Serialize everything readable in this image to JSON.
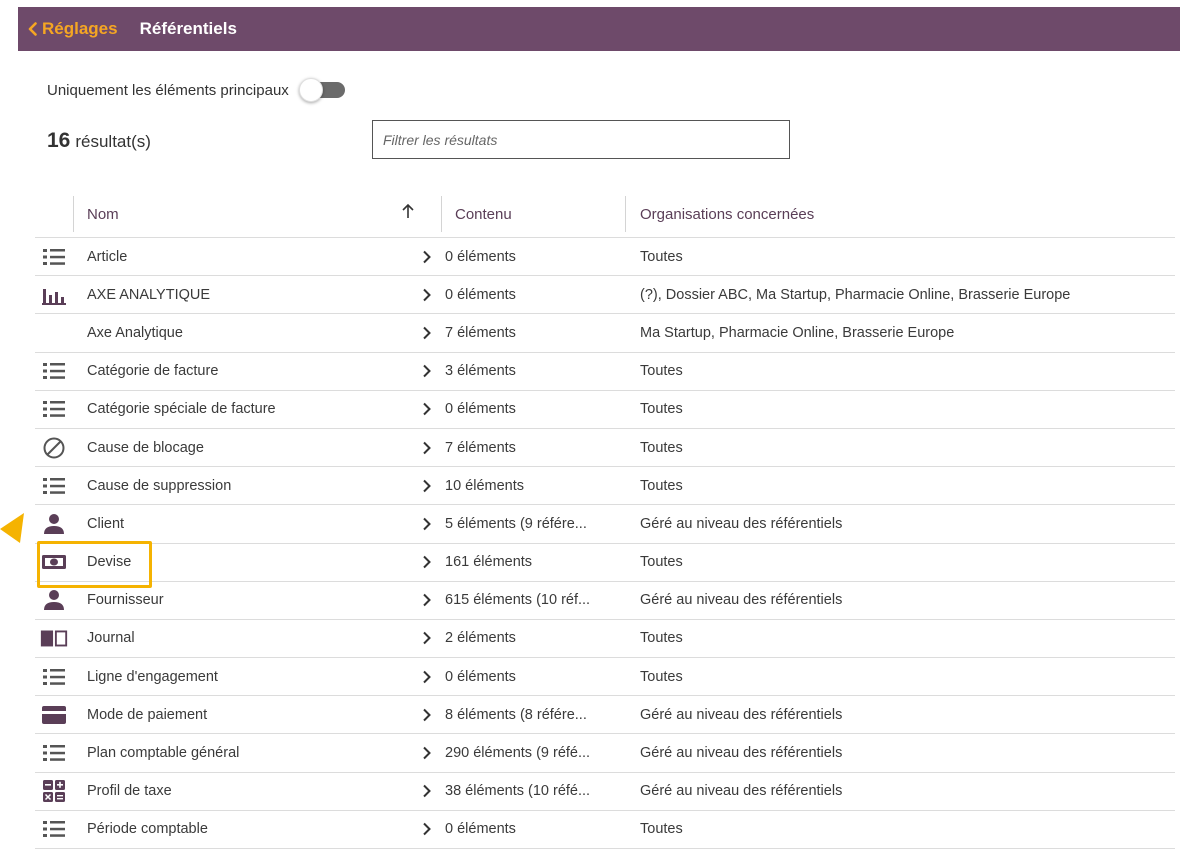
{
  "header": {
    "back_label": "Réglages",
    "title": "Référentiels",
    "colors": {
      "bar": "#6e4a6a",
      "accent": "#f5a623"
    }
  },
  "toggle": {
    "label": "Uniquement les éléments principaux",
    "on": false
  },
  "results": {
    "count": "16",
    "label": "résultat(s)"
  },
  "filter": {
    "placeholder": "Filtrer les résultats",
    "value": ""
  },
  "table": {
    "columns": {
      "name": "Nom",
      "content": "Contenu",
      "orgs": "Organisations concernées"
    },
    "sort": {
      "column": "name",
      "direction": "ascending",
      "icon": "arrow-up-icon"
    },
    "rows": [
      {
        "icon": "list",
        "name": "Article",
        "content": "0 éléments",
        "orgs": "Toutes"
      },
      {
        "icon": "bar-chart",
        "name": "AXE ANALYTIQUE",
        "content": "0 éléments",
        "orgs": "(?), Dossier ABC, Ma Startup, Pharmacie Online, Brasserie Europe"
      },
      {
        "icon": "",
        "name": "Axe Analytique",
        "content": "7 éléments",
        "orgs": "Ma Startup, Pharmacie Online, Brasserie Europe"
      },
      {
        "icon": "list",
        "name": "Catégorie de facture",
        "content": "3 éléments",
        "orgs": "Toutes"
      },
      {
        "icon": "list",
        "name": "Catégorie spéciale de facture",
        "content": "0 éléments",
        "orgs": "Toutes"
      },
      {
        "icon": "block",
        "name": "Cause de blocage",
        "content": "7 éléments",
        "orgs": "Toutes"
      },
      {
        "icon": "list",
        "name": "Cause de suppression",
        "content": "10 éléments",
        "orgs": "Toutes"
      },
      {
        "icon": "person",
        "name": "Client",
        "content": "5 éléments (9 référe...",
        "orgs": "Géré au niveau des référentiels"
      },
      {
        "icon": "money",
        "name": "Devise",
        "content": "161 éléments",
        "orgs": "Toutes"
      },
      {
        "icon": "person",
        "name": "Fournisseur",
        "content": "615 éléments (10 réf...",
        "orgs": "Géré au niveau des référentiels"
      },
      {
        "icon": "book",
        "name": "Journal",
        "content": "2 éléments",
        "orgs": "Toutes"
      },
      {
        "icon": "list",
        "name": "Ligne d'engagement",
        "content": "0 éléments",
        "orgs": "Toutes"
      },
      {
        "icon": "card",
        "name": "Mode de paiement",
        "content": "8 éléments (8 référe...",
        "orgs": "Géré au niveau des référentiels"
      },
      {
        "icon": "list",
        "name": "Plan comptable général",
        "content": "290 éléments (9 réfé...",
        "orgs": "Géré au niveau des référentiels"
      },
      {
        "icon": "calculator",
        "name": "Profil de taxe",
        "content": "38 éléments (10 réfé...",
        "orgs": "Géré au niveau des référentiels"
      },
      {
        "icon": "list",
        "name": "Période comptable",
        "content": "0 éléments",
        "orgs": "Toutes"
      }
    ]
  },
  "annotation": {
    "highlighted_row": "Devise",
    "color": "#f5b301"
  }
}
